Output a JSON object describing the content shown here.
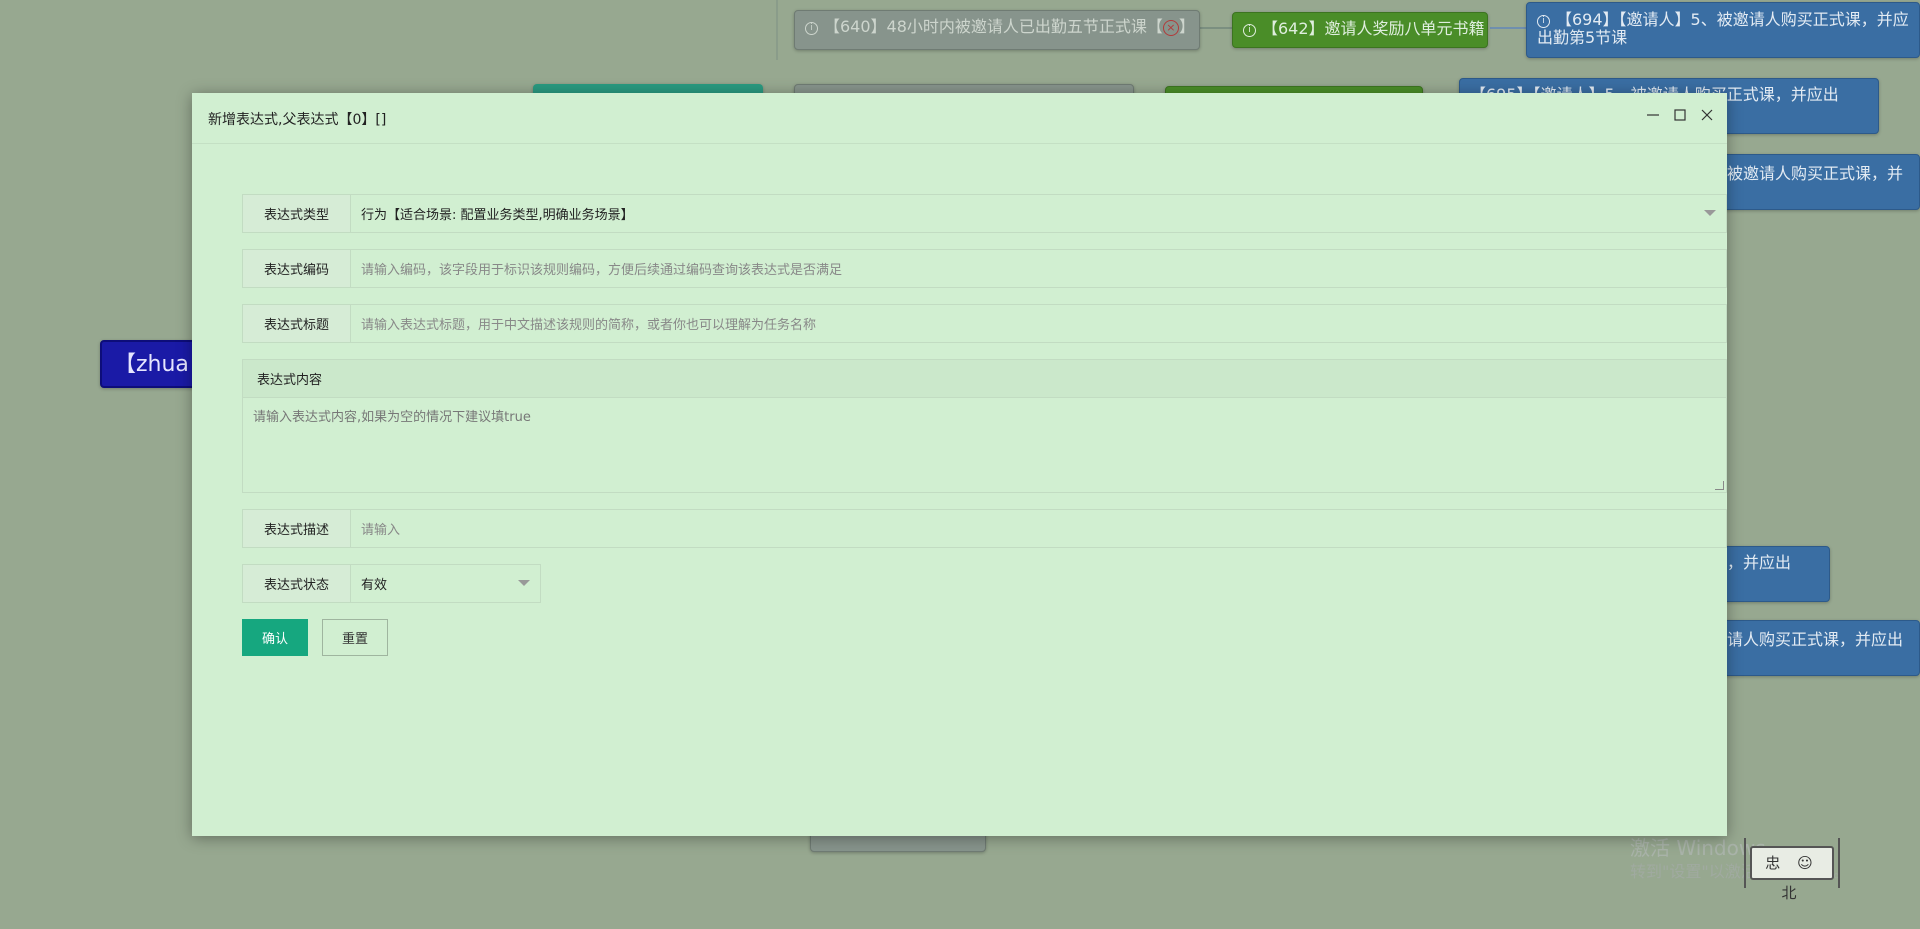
{
  "background": {
    "nodes": [
      "【640】48小时内被邀请人已出勤五节正式课【",
      "】",
      "【642】邀请人奖励八单元书籍",
      "【694】【邀请人】5、被邀请人购买正式课，并应出勤第5节课",
      "【695】【邀请人】5、被邀请人购买正式课，并应出",
      "、被邀请人购买正式课，并",
      "课，并应出",
      "邀请人购买正式课，并应出",
      "【zhua"
    ],
    "watermark_title": "激活 Windows",
    "watermark_sub": "转到\"设置\"以激活 Windows。",
    "stamp_text": "忠 ☺ 北"
  },
  "modal": {
    "title": "新增表达式,父表达式【0】[]",
    "fields": {
      "type_label": "表达式类型",
      "type_value": "行为【适合场景: 配置业务类型,明确业务场景】",
      "code_label": "表达式编码",
      "code_placeholder": "请输入编码，该字段用于标识该规则编码，方便后续通过编码查询该表达式是否满足",
      "title_label": "表达式标题",
      "title_placeholder": "请输入表达式标题，用于中文描述该规则的简称，或者你也可以理解为任务名称",
      "content_label": "表达式内容",
      "content_placeholder": "请输入表达式内容,如果为空的情况下建议填true",
      "desc_label": "表达式描述",
      "desc_placeholder": "请输入",
      "status_label": "表达式状态",
      "status_value": "有效"
    },
    "buttons": {
      "confirm": "确认",
      "reset": "重置"
    }
  }
}
